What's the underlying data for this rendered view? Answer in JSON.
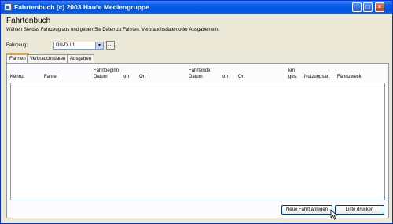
{
  "window": {
    "title": "Fahrtenbuch (c) 2003 Haufe Mediengruppe"
  },
  "titlebar": {
    "minimize": "_",
    "maximize": "□",
    "close": "×"
  },
  "heading": "Fahrtenbuch",
  "subtext": "Wählen Sie das Fahrzeug aus und geben Sie Daten zu Fahrten, Verbrauchsdaten oder Ausgaben ein.",
  "fahrzeug": {
    "label": "Fahrzeug:",
    "value": "DU-DU 1",
    "arrow": "▼",
    "button": "..."
  },
  "tabs": [
    "Fahrten",
    "Verbrauchsdaten",
    "Ausgaben"
  ],
  "table": {
    "group_beginn": "Fahrtbeginn:",
    "group_ende": "Fahrtende:",
    "columns": {
      "kennz": "Kennz.",
      "fahrer": "Fahrer",
      "datum1": "Datum",
      "km1": "km",
      "ort1": "Ort",
      "datum2": "Datum",
      "km2": "km",
      "ort2": "Ort",
      "km_ges_1": "km",
      "km_ges_2": "ges.",
      "nutzungsart": "Nutzungsart",
      "fahrtzweck": "Fahrtzweck"
    }
  },
  "buttons": {
    "new_trip": "Neue Fahrt anlegen",
    "print_list": "Liste drucken"
  }
}
